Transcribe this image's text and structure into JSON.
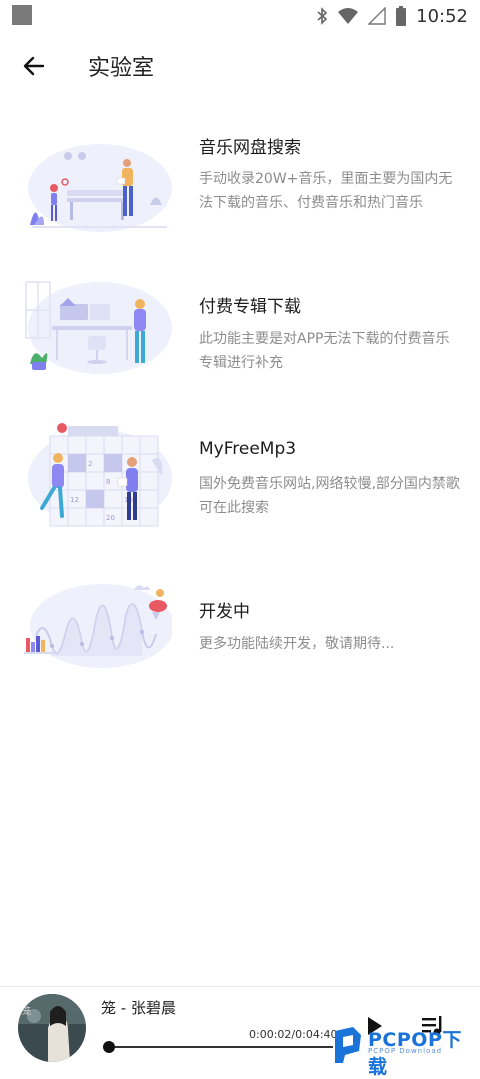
{
  "status": {
    "time": "10:52"
  },
  "header": {
    "title": "实验室",
    "back_icon": "arrow-left-icon"
  },
  "items": [
    {
      "title": "音乐网盘搜索",
      "desc": "手动收录20W+音乐，里面主要为国内无法下载的音乐、付费音乐和热门音乐"
    },
    {
      "title": "付费专辑下载",
      "desc": "此功能主要是对APP无法下载的付费音乐专辑进行补充"
    },
    {
      "title": "MyFreeMp3",
      "desc": "国外免费音乐网站,网络较慢,部分国内禁歌可在此搜索"
    },
    {
      "title": "开发中",
      "desc": "更多功能陆续开发，敬请期待..."
    }
  ],
  "calendar_numbers": [
    "2",
    "8",
    "9",
    "12",
    "16",
    "20"
  ],
  "player": {
    "song": "笼 - 张碧晨",
    "time": "0:00:02/0:04:40",
    "progress": 0.007
  },
  "watermark": {
    "text": "PCPOP下载",
    "sub": "PCPOP Download"
  },
  "colors": {
    "accent": "#7f7ff0",
    "purple": "#8f88f2",
    "pink": "#e85a63",
    "blue_logo": "#1a73d9"
  }
}
